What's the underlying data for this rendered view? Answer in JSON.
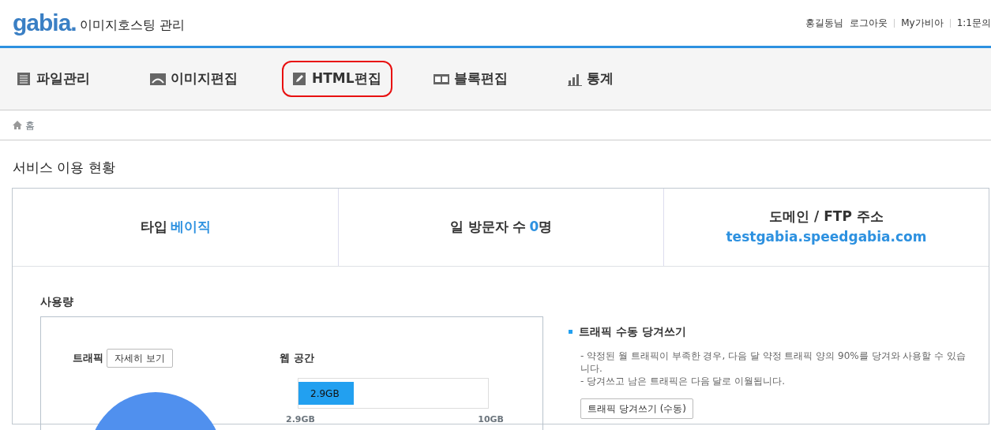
{
  "header": {
    "logo": "gabia.",
    "title": "이미지호스팅 관리",
    "links": [
      "홍길동님",
      "로그아웃",
      "My가비아",
      "1:1문의"
    ]
  },
  "nav": [
    {
      "label": "파일관리",
      "kind": "list",
      "selected": false
    },
    {
      "label": "이미지편집",
      "kind": "image",
      "selected": false
    },
    {
      "label": "HTML편집",
      "kind": "pencil",
      "selected": true
    },
    {
      "label": "블록편집",
      "kind": "blocks",
      "selected": false
    },
    {
      "label": "통계",
      "kind": "chart",
      "selected": false
    }
  ],
  "breadcrumb": "홈",
  "page_title": "서비스 이용 현황",
  "stats": [
    {
      "label": "타입",
      "value": "베이직",
      "kind": "inline"
    },
    {
      "label": "일 방문자 수",
      "value": "0",
      "suffix": "명",
      "kind": "inline"
    },
    {
      "label": "도메인 / FTP 주소",
      "value": "testgabia.speedgabia.com",
      "kind": "stacked"
    }
  ],
  "usage": {
    "title": "사용량",
    "traffic": {
      "label": "트래픽",
      "button": "자세히 보기"
    },
    "web_space": {
      "label": "웹 공간",
      "bar_text": "2.9GB",
      "level": 0.29,
      "min_label": "2.9GB",
      "max_label": "10GB"
    }
  },
  "pull": {
    "title": "트래픽 수동 당겨쓰기",
    "notes": [
      "- 약정된 월 트래픽이 부족한 경우, 다음 달 약정 트래픽 양의 90%를 당겨와 사용할 수 있습니다.",
      "- 당겨쓰고 남은 트래픽은 다음 달로 이월됩니다."
    ],
    "button": "트래픽 당겨쓰기 (수동)"
  }
}
